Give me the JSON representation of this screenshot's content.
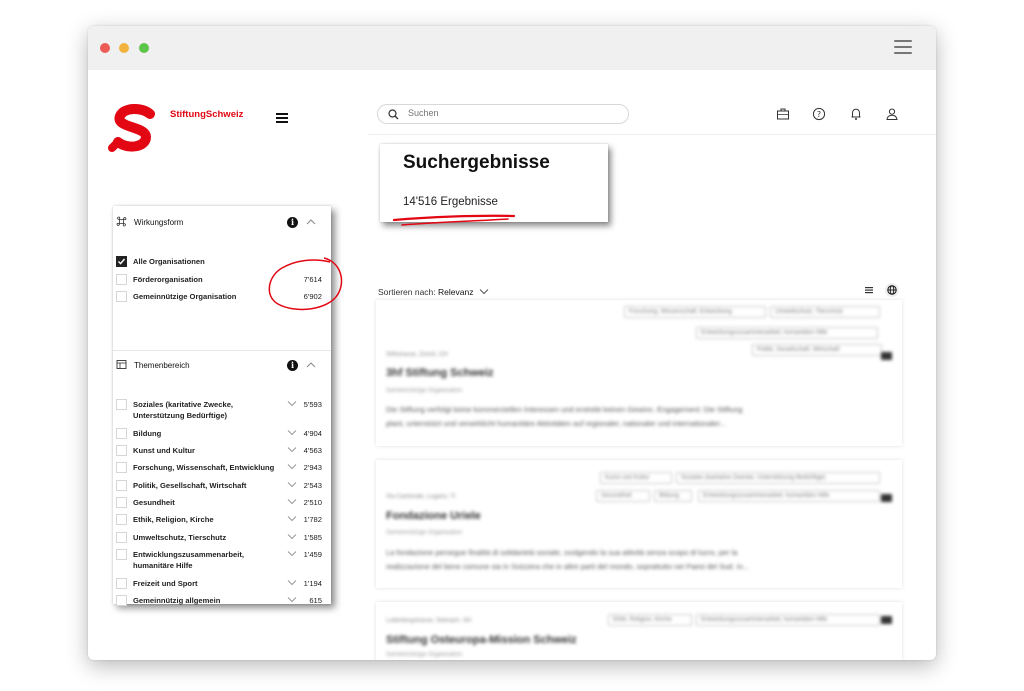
{
  "app": {
    "brand": "StiftungSchweiz",
    "brand_color": "#e30613",
    "search_placeholder": "Suchen",
    "header_icons": [
      "briefcase-icon",
      "help-icon",
      "bell-icon",
      "user-icon"
    ]
  },
  "results": {
    "title": "Suchergebnisse",
    "count": "14'516 Ergebnisse"
  },
  "filters": {
    "wirkungsform": {
      "title": "Wirkungsform",
      "items": [
        {
          "label": "Alle Organisationen",
          "count": "",
          "checked": true
        },
        {
          "label": "Förderorganisation",
          "count": "7'614",
          "checked": false
        },
        {
          "label": "Gemeinnützige Organisation",
          "count": "6'902",
          "checked": false
        }
      ]
    },
    "themenbereich": {
      "title": "Themenbereich",
      "items": [
        {
          "label": "Soziales (karitative Zwecke,",
          "label2": "Unterstützung Bedürftige)",
          "count": "5'593"
        },
        {
          "label": "Bildung",
          "count": "4'904"
        },
        {
          "label": "Kunst und Kultur",
          "count": "4'563"
        },
        {
          "label": "Forschung, Wissenschaft, Entwicklung",
          "count": "2'943"
        },
        {
          "label": "Politik, Gesellschaft, Wirtschaft",
          "count": "2'543"
        },
        {
          "label": "Gesundheit",
          "count": "2'510"
        },
        {
          "label": "Ethik, Religion, Kirche",
          "count": "1'782"
        },
        {
          "label": "Umweltschutz, Tierschutz",
          "count": "1'585"
        },
        {
          "label": "Entwicklungszusammenarbeit,",
          "label2": "humanitäre Hilfe",
          "count": "1'459"
        },
        {
          "label": "Freizeit und Sport",
          "count": "1'194"
        },
        {
          "label": "Gemeinnützig allgemein",
          "count": "615"
        }
      ]
    }
  },
  "sort": {
    "label": "Sortieren nach:",
    "value": "Relevanz"
  },
  "cards": [
    {
      "tags": [
        "Forschung, Wissenschaft, Entwicklung",
        "Umweltschutz, Tierschutz",
        "Entwicklungszusammenarbeit, humanitäre Hilfe",
        "Politik, Gesellschaft, Wirtschaft"
      ],
      "location": "Stiftstrasse, Zürich, CH",
      "title": "3hf Stiftung Schweiz",
      "type": "Gemeinnützige Organisation",
      "desc1": "Die Stiftung verfolgt keine kommerziellen Interessen und erstrebt keinen Gewinn. Engagement: Die Stiftung",
      "desc2": "plant, unterstützt und verwirklicht humanitäre Aktivitäten auf regionaler, nationaler und internationaler..."
    },
    {
      "tags": [
        "Kunst und Kultur",
        "Soziales (karitative Zwecke, Unterstützung Bedürftige)",
        "Gesundheit",
        "Bildung",
        "Entwicklungszusammenarbeit, humanitäre Hilfe"
      ],
      "location": "Via Cantonale, Lugano, TI",
      "title": "Fondazione Uriele",
      "type": "Gemeinnützige Organisation",
      "desc1": "La fondazione persegue finalità di solidarietà sociale, svolgendo la sua attività senza scopo di lucro, per la",
      "desc2": "realizzazione del bene comune sia in Svizzera che in altre parti del mondo, soprattutto nei Paesi del Sud. In..."
    },
    {
      "tags": [
        "Ethik, Religion, Kirche",
        "Entwicklungszusammenarbeit, humanitäre Hilfe"
      ],
      "location": "Lutterbergstrasse, Steinach, SH",
      "title": "Stiftung Osteuropa-Mission Schweiz",
      "type": "Gemeinnützige Organisation",
      "desc1": "",
      "desc2": ""
    }
  ]
}
